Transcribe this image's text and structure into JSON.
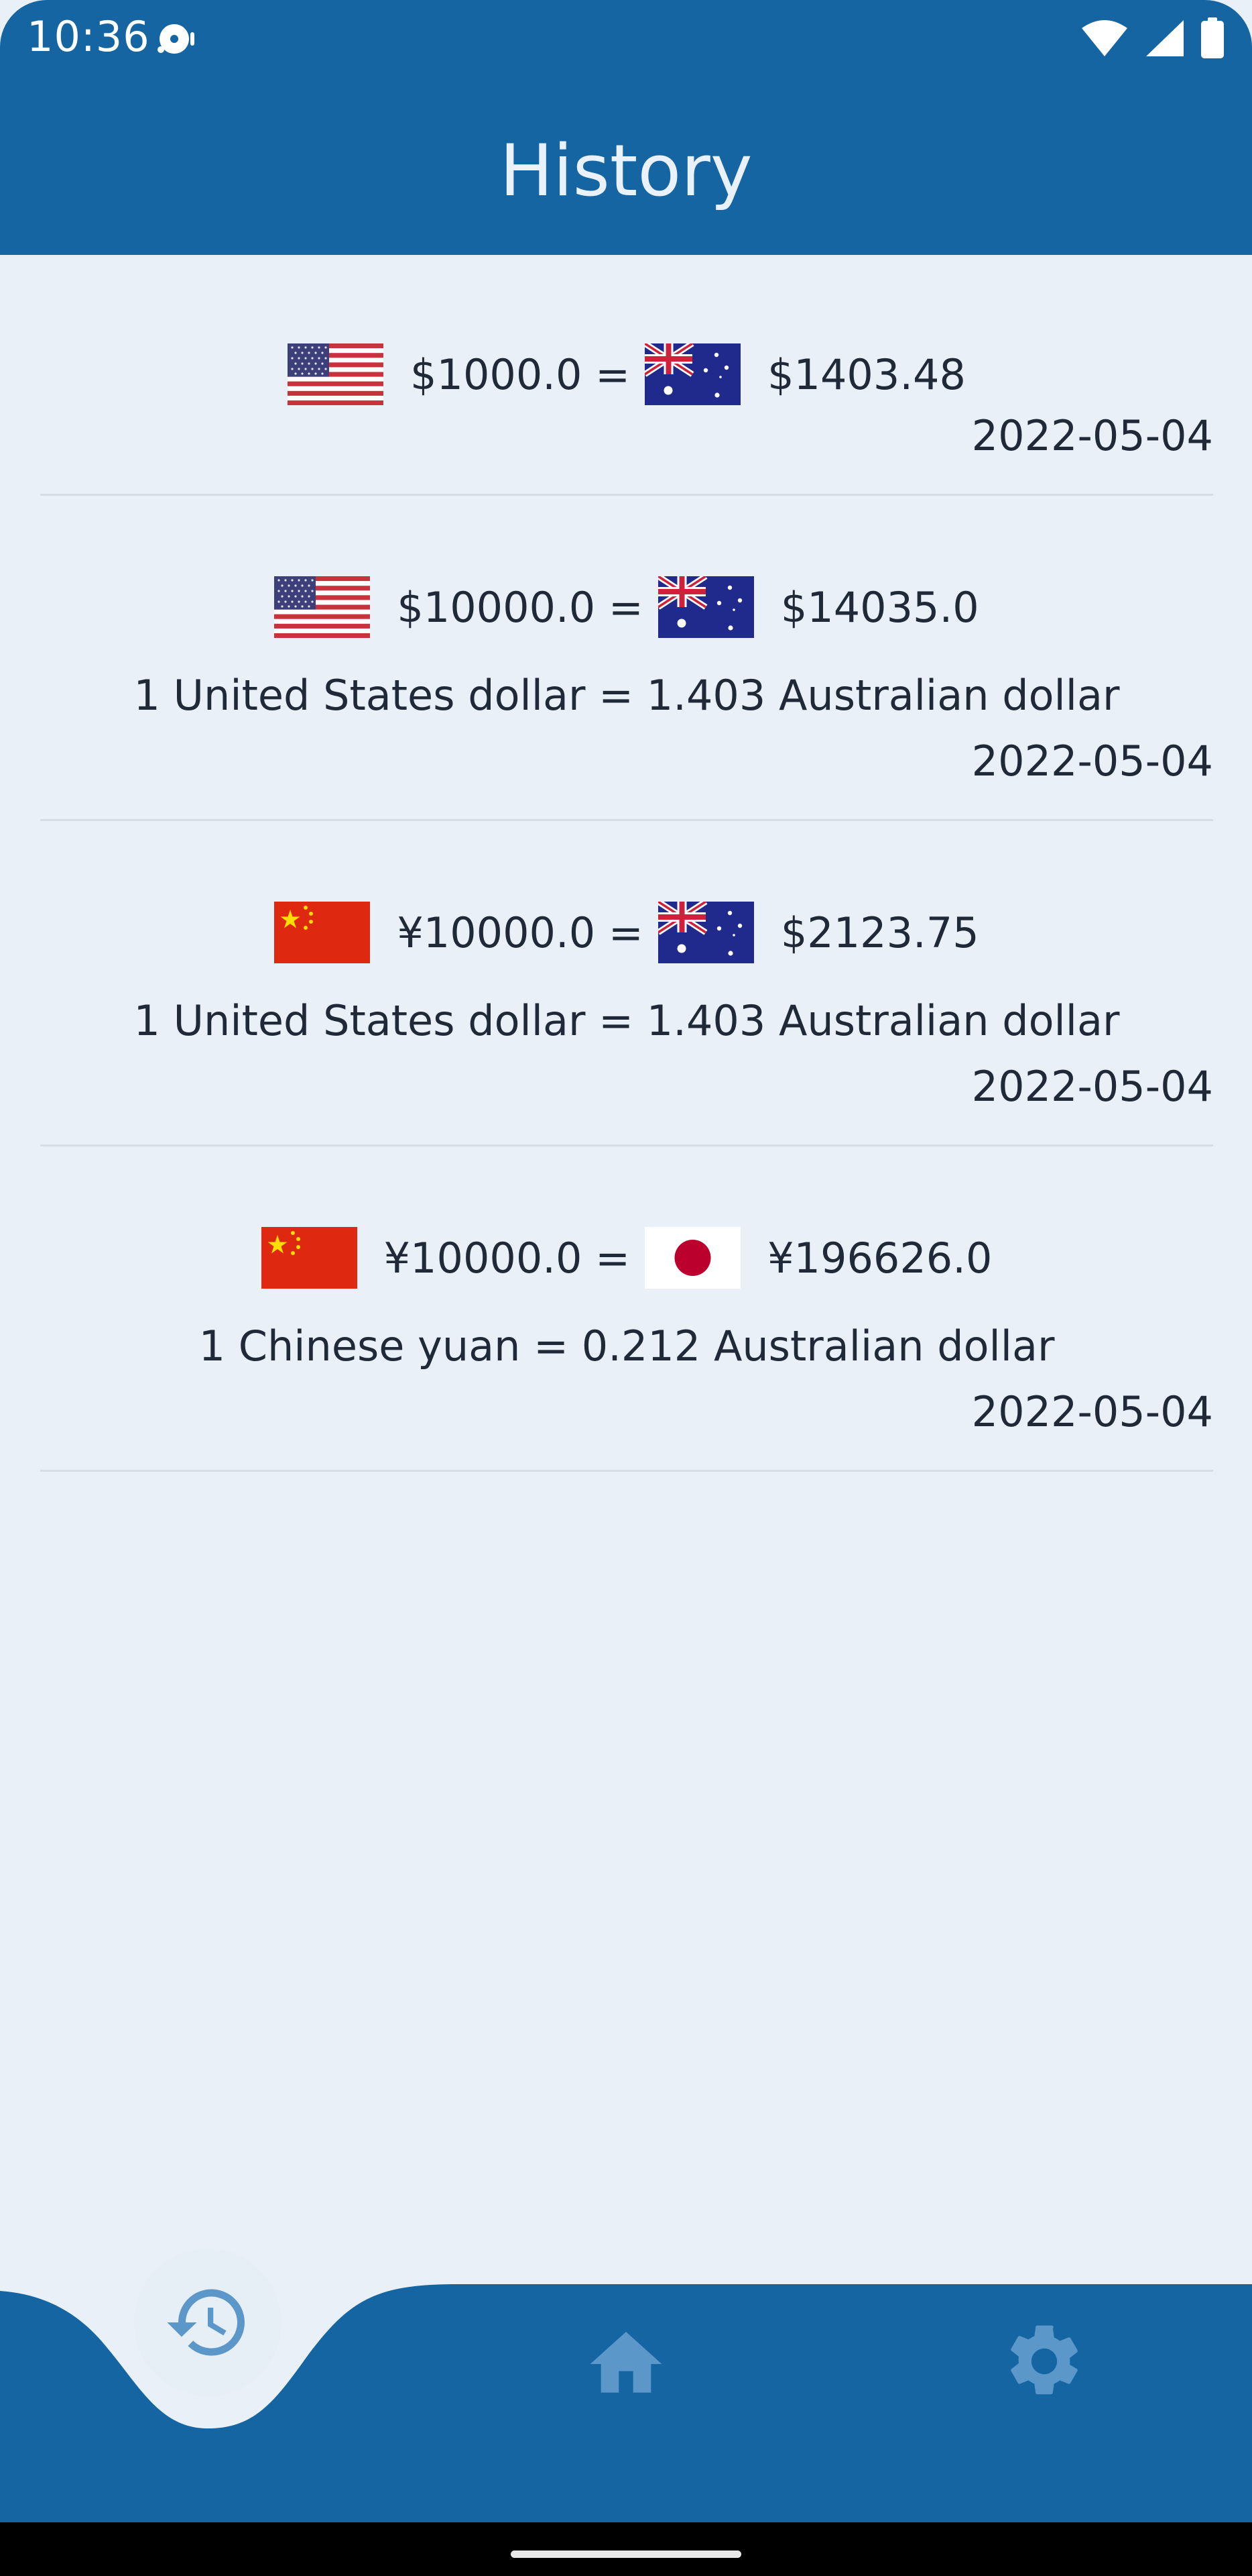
{
  "status_bar": {
    "time": "10:36",
    "icons": [
      "media-notification-icon",
      "wifi-icon",
      "signal-icon",
      "battery-icon"
    ]
  },
  "header": {
    "title": "History"
  },
  "history": [
    {
      "from_flag": "us-flag-icon",
      "from_amount": "$1000.0 =",
      "to_flag": "au-flag-icon",
      "to_amount": "$1403.48",
      "rate": "",
      "date": "2022-05-04"
    },
    {
      "from_flag": "us-flag-icon",
      "from_amount": "$10000.0 =",
      "to_flag": "au-flag-icon",
      "to_amount": "$14035.0",
      "rate": "1 United States dollar = 1.403 Australian dollar",
      "date": "2022-05-04"
    },
    {
      "from_flag": "cn-flag-icon",
      "from_amount": "¥10000.0 =",
      "to_flag": "au-flag-icon",
      "to_amount": "$2123.75",
      "rate": "1 United States dollar = 1.403 Australian dollar",
      "date": "2022-05-04"
    },
    {
      "from_flag": "cn-flag-icon",
      "from_amount": "¥10000.0 =",
      "to_flag": "jp-flag-icon",
      "to_amount": "¥196626.0",
      "rate": "1 Chinese yuan = 0.212 Australian dollar",
      "date": "2022-05-04"
    }
  ],
  "bottom_nav": {
    "items": [
      {
        "icon": "history-icon",
        "active": true
      },
      {
        "icon": "home-icon",
        "active": false
      },
      {
        "icon": "settings-icon",
        "active": false
      }
    ]
  },
  "colors": {
    "primary": "#1565a3",
    "background": "#eaf0f7",
    "inactive_icon": "#5c97ca",
    "text": "#1f2937"
  }
}
